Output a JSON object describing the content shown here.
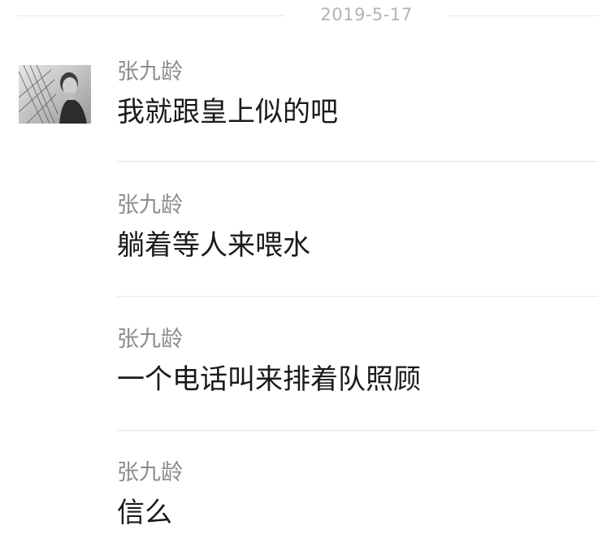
{
  "date_divider": "2019-5-17",
  "avatar": {
    "icon": "user-avatar-photo"
  },
  "messages": [
    {
      "sender": "张九龄",
      "text": "我就跟皇上似的吧"
    },
    {
      "sender": "张九龄",
      "text": "躺着等人来喂水"
    },
    {
      "sender": "张九龄",
      "text": "一个电话叫来排着队照顾"
    },
    {
      "sender": "张九龄",
      "text": "信么"
    }
  ],
  "colors": {
    "background": "#ffffff",
    "divider": "#e6e6e6",
    "date_text": "#b3b3b3",
    "sender_name": "#8c8c8c",
    "message_text": "#1a1a1a"
  }
}
